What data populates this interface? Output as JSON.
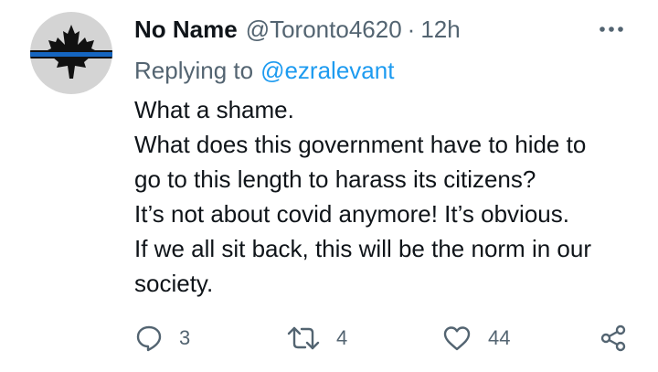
{
  "tweet": {
    "display_name": "No Name",
    "handle": "@Toronto4620",
    "separator": "·",
    "time": "12h",
    "replying_prefix": "Replying to",
    "replying_to": "@ezralevant",
    "body_lines": [
      "What a shame.",
      "What does this government have to hide to",
      "go to this length to harass its citizens?",
      "It’s not about covid anymore! It’s obvious.",
      "If we all sit back, this will be the norm in our",
      "society."
    ]
  },
  "actions": {
    "reply_count": "3",
    "retweet_count": "4",
    "like_count": "44"
  },
  "icons": {
    "avatar": "maple-leaf-thin-blue-line-icon",
    "more": "more-horizontal-icon",
    "reply": "reply-icon",
    "retweet": "retweet-icon",
    "like": "heart-icon",
    "share": "share-icon"
  },
  "colors": {
    "text": "#0f1419",
    "secondary": "#536471",
    "link": "#1d9bf0",
    "avatar_bg": "#d4d4d4",
    "avatar_stripe": "#1565c0"
  }
}
